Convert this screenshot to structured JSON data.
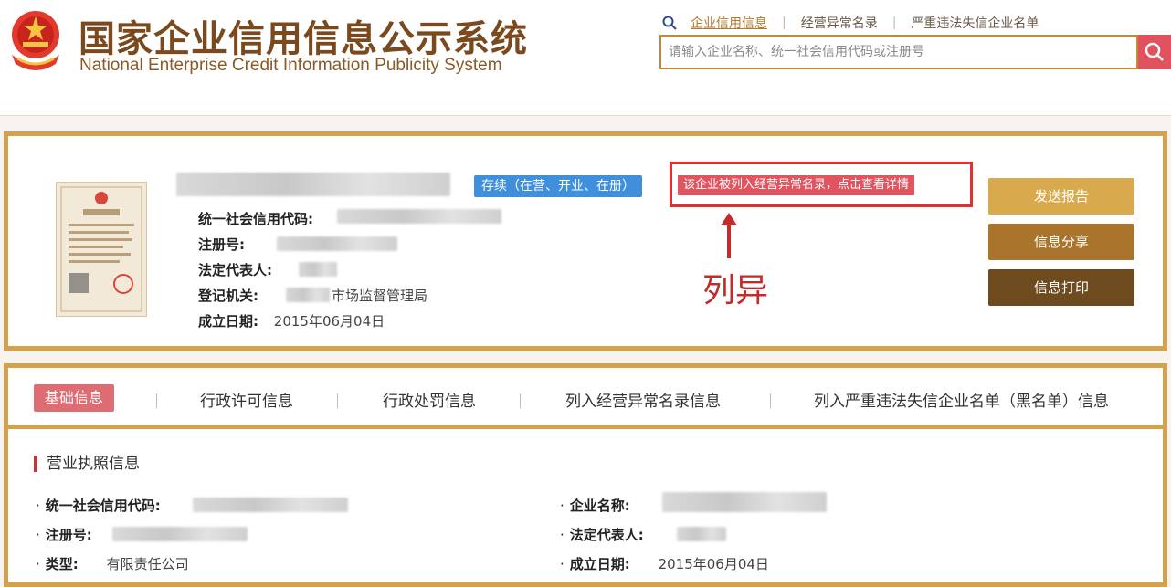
{
  "header": {
    "title_cn": "国家企业信用信息公示系统",
    "title_en": "National Enterprise Credit Information Publicity System",
    "search_tabs": [
      "企业信用信息",
      "经营异常名录",
      "严重违法失信企业名单"
    ],
    "search_placeholder": "请输入企业名称、统一社会信用代码或注册号"
  },
  "company": {
    "status": "存续（在营、开业、在册）",
    "abnormal_notice": "该企业被列入经营异常名录，点击查看详情",
    "annotation": "列异",
    "fields": [
      {
        "label": "统一社会信用代码:",
        "value": ""
      },
      {
        "label": "注册号:",
        "value": ""
      },
      {
        "label": "法定代表人:",
        "value": ""
      },
      {
        "label": "登记机关:",
        "value": "市场监督管理局"
      },
      {
        "label": "成立日期:",
        "value": "2015年06月04日"
      }
    ],
    "buttons": [
      "发送报告",
      "信息分享",
      "信息打印"
    ],
    "license_image_text": "营业执照"
  },
  "detail": {
    "tabs": [
      "基础信息",
      "行政许可信息",
      "行政处罚信息",
      "列入经营异常名录信息",
      "列入严重违法失信企业名单（黑名单）信息"
    ],
    "section_title": "营业执照信息",
    "left_fields": [
      {
        "label": "统一社会信用代码:",
        "value": ""
      },
      {
        "label": "注册号:",
        "value": ""
      },
      {
        "label": "类型:",
        "value": "有限责任公司"
      }
    ],
    "right_fields": [
      {
        "label": "企业名称:",
        "value": ""
      },
      {
        "label": "法定代表人:",
        "value": ""
      },
      {
        "label": "成立日期:",
        "value": "2015年06月04日"
      }
    ]
  },
  "colors": {
    "gold_border": "#d4a24c",
    "button_1": "#d9a94e",
    "button_2": "#a9752c",
    "button_3": "#6e4a1f",
    "status_blue": "#3f8fdc",
    "alert_red": "#e03030"
  },
  "icons": [
    "national-emblem-icon",
    "search-icon",
    "magnifier-icon",
    "arrow-up-icon"
  ]
}
